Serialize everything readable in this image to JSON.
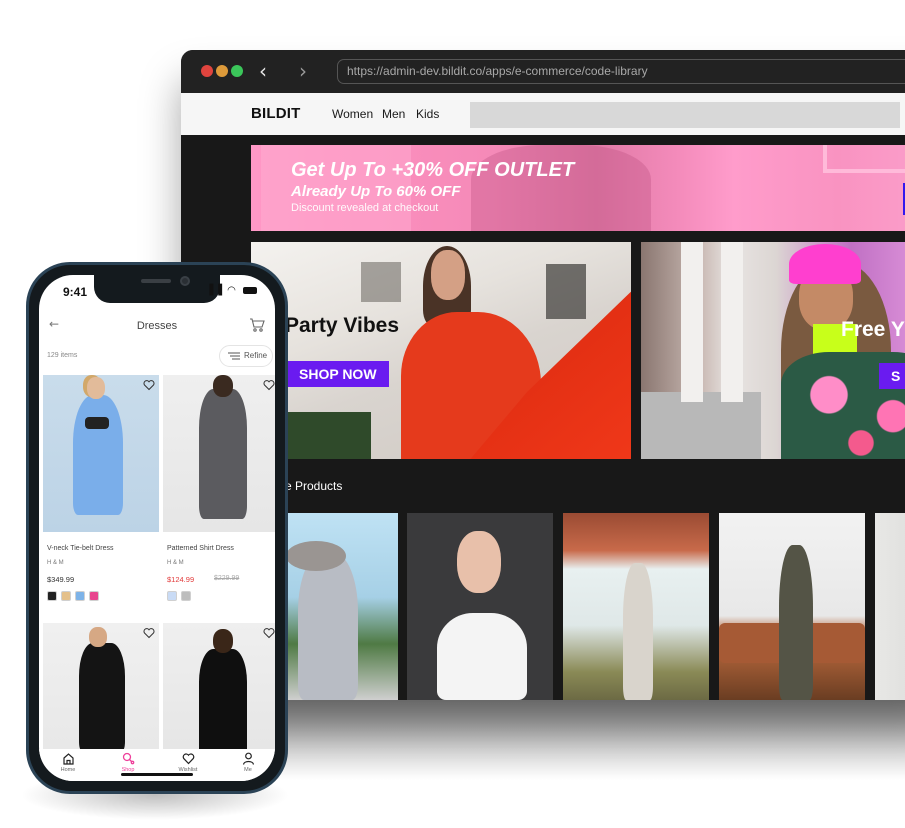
{
  "browser": {
    "url": "https://admin-dev.bildit.co/apps/e-commerce/code-library",
    "site": {
      "logo": "BILDIT",
      "nav": [
        "Women",
        "Men",
        "Kids"
      ],
      "promo": {
        "headline": "Get Up To  +30% OFF OUTLET",
        "subheadline": "Already Up To 60% OFF",
        "note": "Discount revealed at checkout"
      },
      "heroes": [
        {
          "title": "Party Vibes",
          "cta": "SHOP NOW"
        },
        {
          "title": "Free Y",
          "cta": "S"
        }
      ],
      "section_title": "e Products",
      "accent_color": "#6a1bf0"
    }
  },
  "phone": {
    "status": {
      "time": "9:41"
    },
    "header": {
      "title": "Dresses",
      "back_icon": "arrow-left-icon",
      "cart_icon": "cart-icon"
    },
    "items_count": "129 items",
    "refine_label": "Refine",
    "products": [
      {
        "name": "V-neck Tie-belt Dress",
        "brand": "H & M",
        "price": "$349.99",
        "swatches": [
          "#222222",
          "#e4c08a",
          "#7db3e8",
          "#e8458e"
        ]
      },
      {
        "name": "Patterned Shirt Dress",
        "brand": "H & M",
        "price": "$124.99",
        "original_price": "$229.99",
        "swatches": [
          "#c9dbf5",
          "#bdbdbd"
        ]
      },
      {
        "name": "",
        "brand": "",
        "price": ""
      },
      {
        "name": "",
        "brand": "",
        "price": ""
      }
    ],
    "tabs": [
      {
        "label": "Home",
        "icon": "home-icon"
      },
      {
        "label": "Shop",
        "icon": "search-icon",
        "active": true
      },
      {
        "label": "Wishlist",
        "icon": "heart-icon"
      },
      {
        "label": "Me",
        "icon": "user-icon"
      }
    ],
    "active_color": "#ee3f9a",
    "sale_color": "#e23b3b"
  }
}
